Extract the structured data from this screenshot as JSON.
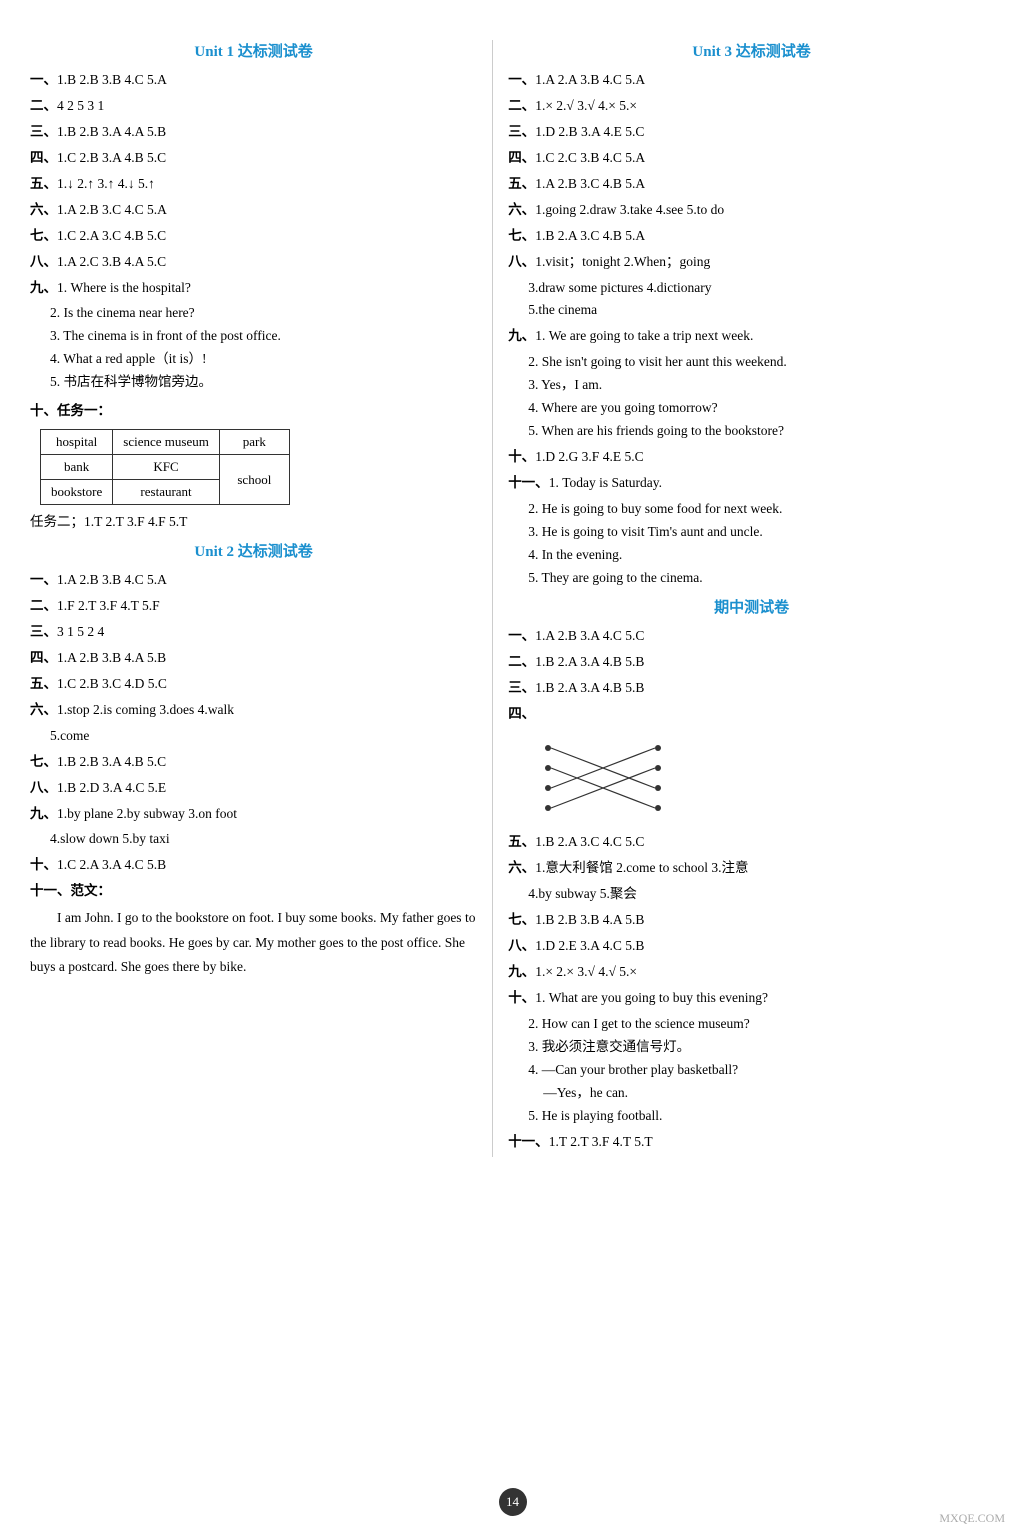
{
  "page": {
    "number": "14",
    "left": {
      "unit1_title": "Unit 1 达标测试卷",
      "sections": [
        {
          "label": "一、",
          "content": "1.B  2.B  3.B  4.C  5.A"
        },
        {
          "label": "二、",
          "content": "4  2  5  3  1"
        },
        {
          "label": "三、",
          "content": "1.B  2.B  3.A  4.A  5.B"
        },
        {
          "label": "四、",
          "content": "1.C  2.B  3.A  4.B  5.C"
        },
        {
          "label": "五、",
          "content": "1.↓  2.↑  3.↑  4.↓  5.↑"
        },
        {
          "label": "六、",
          "content": "1.A  2.B  3.C  4.C  5.A"
        },
        {
          "label": "七、",
          "content": "1.C  2.A  3.C  4.B  5.C"
        },
        {
          "label": "八、",
          "content": "1.A  2.C  3.B  4.A  5.C"
        }
      ],
      "section9_label": "九、",
      "section9_items": [
        "1. Where is the hospital?",
        "2. Is the cinema near here?",
        "3. The cinema is in front of the post office.",
        "4. What a red apple（it is）!",
        "5. 书店在科学博物馆旁边。"
      ],
      "section10_label": "十、任务一：",
      "map_rows": [
        [
          "hospital",
          "science museum",
          "park"
        ],
        [
          "bank",
          "KFC",
          ""
        ],
        [
          "bookstore",
          "restaurant",
          "school"
        ]
      ],
      "task2": "任务二；1.T  2.T  3.F  4.F  5.T",
      "unit2_title": "Unit 2 达标测试卷",
      "u2_sections": [
        {
          "label": "一、",
          "content": "1.A  2.B  3.B  4.C  5.A"
        },
        {
          "label": "二、",
          "content": "1.F  2.T  3.F  4.T  5.F"
        },
        {
          "label": "三、",
          "content": "3  1  5  2  4"
        },
        {
          "label": "四、",
          "content": "1.A  2.B  3.B  4.A  5.B"
        },
        {
          "label": "五、",
          "content": "1.C  2.B  3.C  4.D  5.C"
        }
      ],
      "u2_section6_label": "六、",
      "u2_section6": "1.stop  2.is coming  3.does  4.walk",
      "u2_section6b": "5.come",
      "u2_sections2": [
        {
          "label": "七、",
          "content": "1.B  2.B  3.A  4.B  5.C"
        },
        {
          "label": "八、",
          "content": "1.B  2.D  3.A  4.C  5.E"
        }
      ],
      "u2_section9_label": "九、",
      "u2_section9_items": [
        "1.by plane  2.by subway  3.on foot",
        "4.slow down  5.by taxi"
      ],
      "u2_sections3": [
        {
          "label": "十、",
          "content": "1.C  2.A  3.A  4.C  5.B"
        }
      ],
      "u2_section11_label": "十一、范文：",
      "essay_lines": [
        "I am John. I go to the bookstore on foot. I",
        "buy some books. My father goes to the library",
        "to read books. He goes by car. My mother goes",
        "to the post office. She buys a postcard. She",
        "goes there by bike."
      ]
    },
    "right": {
      "unit3_title": "Unit 3 达标测试卷",
      "sections": [
        {
          "label": "一、",
          "content": "1.A  2.A  3.B  4.C  5.A"
        },
        {
          "label": "二、",
          "content": "1.×  2.√  3.√  4.×  5.×"
        },
        {
          "label": "三、",
          "content": "1.D  2.B  3.A  4.E  5.C"
        },
        {
          "label": "四、",
          "content": "1.C  2.C  3.B  4.C  5.A"
        },
        {
          "label": "五、",
          "content": "1.A  2.B  3.C  4.B  5.A"
        }
      ],
      "u3_section6_label": "六、",
      "u3_section6": "1.going  2.draw  3.take  4.see  5.to do",
      "u3_sections2": [
        {
          "label": "七、",
          "content": "1.B  2.A  3.C  4.B  5.A"
        }
      ],
      "u3_section8_label": "八、",
      "u3_section8": "1.visit；tonight  2.When；going",
      "u3_section8b": "3.draw some pictures  4.dictionary",
      "u3_section8c": "5.the cinema",
      "u3_section9_label": "九、",
      "u3_section9_items": [
        "1. We are going to take a trip next week.",
        "2. She isn't going to visit her aunt this weekend.",
        "3. Yes，I am.",
        "4. Where are you going tomorrow?",
        "5. When are his friends going to the bookstore?"
      ],
      "u3_sections3": [
        {
          "label": "十、",
          "content": "1.D  2.G  3.F  4.E  5.C"
        }
      ],
      "u3_section11_label": "十一、",
      "u3_section11_items": [
        "1. Today is Saturday.",
        "2. He is going to buy some food for next week.",
        "3. He is going to visit Tim's aunt and uncle.",
        "4. In the evening.",
        "5. They are going to the cinema."
      ],
      "midterm_title": "期中测试卷",
      "mid_sections": [
        {
          "label": "一、",
          "content": "1.A  2.B  3.A  4.C  5.C"
        },
        {
          "label": "二、",
          "content": "1.B  2.A  3.A  4.B  5.B"
        },
        {
          "label": "三、",
          "content": "1.B  2.A  3.A  4.B  5.B"
        }
      ],
      "mid_section4_label": "四、",
      "mid_sections2": [
        {
          "label": "五、",
          "content": "1.B  2.A  3.C  4.C  5.C"
        }
      ],
      "mid_section6_label": "六、",
      "mid_section6": "1.意大利餐馆  2.come to school  3.注意",
      "mid_section6b": "4.by subway  5.聚会",
      "mid_sections3": [
        {
          "label": "七、",
          "content": "1.B  2.B  3.B  4.A  5.B"
        },
        {
          "label": "八、",
          "content": "1.D  2.E  3.A  4.C  5.B"
        }
      ],
      "mid_section9_label": "九、",
      "mid_section9": "1.×  2.×  3.√  4.√  5.×",
      "mid_section10_label": "十、",
      "mid_section10_items": [
        "1. What are you going to buy this evening?",
        "2. How can I get to the science museum?",
        "3. 我必须注意交通信号灯。",
        "4. —Can your brother play basketball?",
        "   —Yes，he can.",
        "5. He is playing football."
      ],
      "mid_section11_label": "十一、",
      "mid_section11": "1.T  2.T  3.F  4.T  5.T"
    }
  }
}
